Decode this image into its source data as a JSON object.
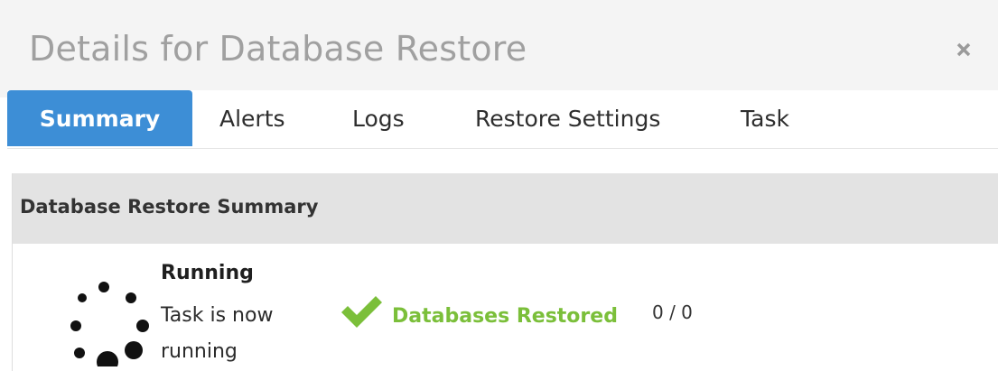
{
  "modal": {
    "title": "Details for Database Restore",
    "close_icon": "close-icon"
  },
  "tabs": [
    {
      "label": "Summary",
      "active": true
    },
    {
      "label": "Alerts",
      "active": false
    },
    {
      "label": "Logs",
      "active": false
    },
    {
      "label": "Restore Settings",
      "active": false
    },
    {
      "label": "Task",
      "active": false
    }
  ],
  "summary": {
    "heading": "Database Restore Summary",
    "status_icon": "loading-spinner-icon",
    "status_title": "Running",
    "status_text": "Task is now running",
    "result_icon": "check-icon",
    "databases_restored_label": "Databases Restored",
    "databases_restored_count": "0 / 0"
  },
  "colors": {
    "active_tab": "#3d8ed6",
    "success": "#7bbf3a",
    "header_bg": "#f4f4f4",
    "panel_heading_bg": "#e3e3e3"
  }
}
